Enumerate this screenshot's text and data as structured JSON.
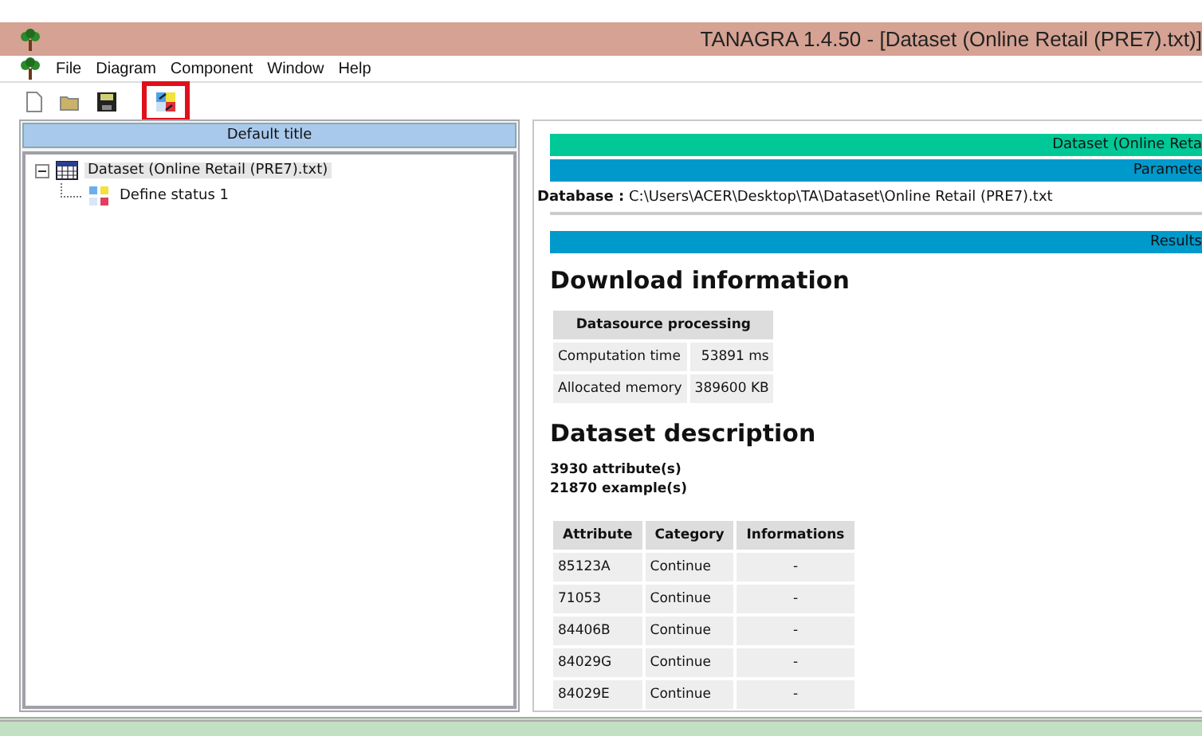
{
  "window": {
    "title": "TANAGRA 1.4.50 - [Dataset (Online Retail (PRE7).txt)]"
  },
  "menu": [
    {
      "label": "File"
    },
    {
      "label": "Diagram"
    },
    {
      "label": "Component"
    },
    {
      "label": "Window"
    },
    {
      "label": "Help"
    }
  ],
  "toolbar": [
    {
      "kind": "new",
      "highlighted": false
    },
    {
      "kind": "open",
      "highlighted": false
    },
    {
      "kind": "save",
      "highlighted": false
    },
    {
      "kind": "execute",
      "highlighted": true
    }
  ],
  "diagram": {
    "title": "Default title",
    "tree": [
      {
        "label": "Dataset (Online Retail (PRE7).txt)",
        "kind": "dataset",
        "selected": true,
        "expanded": true,
        "children": [
          {
            "label": "Define status 1",
            "kind": "status",
            "selected": false
          }
        ]
      }
    ]
  },
  "report": {
    "header": "Dataset (Online Reta",
    "parameters_header": "Paramete",
    "database_label": "Database :",
    "database_path": "C:\\Users\\ACER\\Desktop\\TA\\Dataset\\Online Retail (PRE7).txt",
    "results_header": "Results",
    "download": {
      "heading": "Download information",
      "table_title": "Datasource processing",
      "rows": [
        [
          "Computation time",
          "53891 ms"
        ],
        [
          "Allocated memory",
          "389600 KB"
        ]
      ]
    },
    "description": {
      "heading": "Dataset description",
      "lines": [
        "3930 attribute(s)",
        "21870 example(s)"
      ],
      "columns": [
        "Attribute",
        "Category",
        "Informations"
      ],
      "rows": [
        [
          "85123A",
          "Continue",
          "-"
        ],
        [
          "71053",
          "Continue",
          "-"
        ],
        [
          "84406B",
          "Continue",
          "-"
        ],
        [
          "84029G",
          "Continue",
          "-"
        ],
        [
          "84029E",
          "Continue",
          "-"
        ]
      ]
    }
  }
}
